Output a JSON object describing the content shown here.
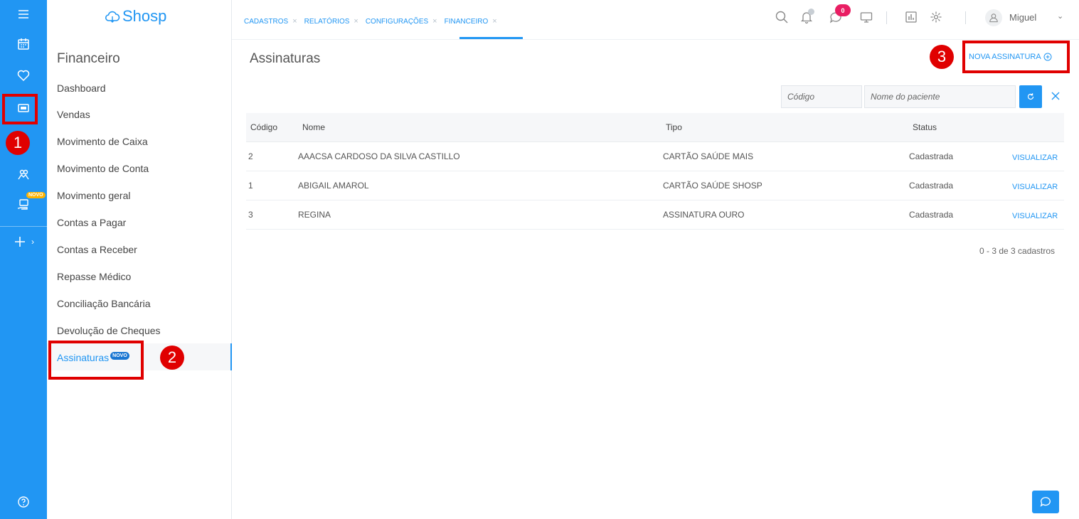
{
  "brand": {
    "name": "Shosp"
  },
  "rail": {
    "items": [
      {
        "icon": "menu-icon"
      },
      {
        "icon": "calendar-icon"
      },
      {
        "icon": "heart-icon"
      },
      {
        "icon": "money-icon"
      },
      {
        "icon": "people-icon"
      },
      {
        "icon": "hand-card-icon",
        "badge": "NOVO"
      },
      {
        "icon": "plus-icon"
      },
      {
        "icon": "help-icon"
      }
    ]
  },
  "annotations": {
    "step1": "1",
    "step2": "2",
    "step3": "3"
  },
  "sidebar": {
    "title": "Financeiro",
    "items": [
      {
        "label": "Dashboard"
      },
      {
        "label": "Vendas"
      },
      {
        "label": "Movimento de Caixa"
      },
      {
        "label": "Movimento de Conta"
      },
      {
        "label": "Movimento geral"
      },
      {
        "label": "Contas a Pagar"
      },
      {
        "label": "Contas a Receber"
      },
      {
        "label": "Repasse Médico"
      },
      {
        "label": "Conciliação Bancária"
      },
      {
        "label": "Devolução de Cheques"
      },
      {
        "label": "Assinaturas",
        "badge": "NOVO",
        "active": true
      }
    ]
  },
  "header": {
    "tabs": [
      {
        "label": "CADASTROS"
      },
      {
        "label": "RELATÓRIOS"
      },
      {
        "label": "CONFIGURAÇÕES"
      },
      {
        "label": "FINANCEIRO",
        "active": true
      }
    ],
    "tab_close": "×",
    "notification_count": "0",
    "user": {
      "name": "Miguel"
    }
  },
  "main": {
    "title": "Assinaturas",
    "new_button": "NOVA ASSINATURA",
    "filters": {
      "code_placeholder": "Código",
      "patient_placeholder": "Nome do paciente"
    },
    "table": {
      "columns": [
        "Código",
        "Nome",
        "Tipo",
        "Status"
      ],
      "rows": [
        {
          "code": "2",
          "name": "AAACSA CARDOSO DA SILVA CASTILLO",
          "type": "CARTÃO SAÚDE MAIS",
          "status": "Cadastrada",
          "action": "VISUALIZAR"
        },
        {
          "code": "1",
          "name": "ABIGAIL AMAROL",
          "type": "CARTÃO SAÚDE SHOSP",
          "status": "Cadastrada",
          "action": "VISUALIZAR"
        },
        {
          "code": "3",
          "name": "REGINA",
          "type": "ASSINATURA OURO",
          "status": "Cadastrada",
          "action": "VISUALIZAR"
        }
      ]
    },
    "pagination": "0 - 3 de 3 cadastros"
  },
  "colors": {
    "primary": "#2196f3",
    "annotation": "#e00000",
    "badge": "#e91e63",
    "novo": "#ffb300"
  }
}
